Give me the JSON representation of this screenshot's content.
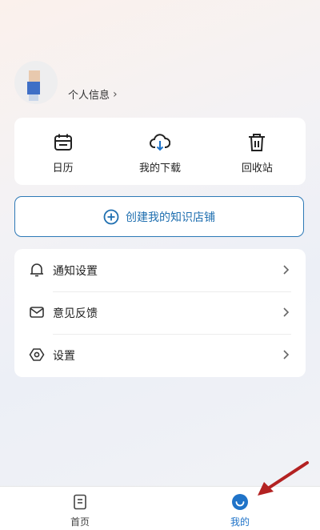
{
  "profile": {
    "info_link": "个人信息"
  },
  "quick_actions": [
    {
      "label": "日历",
      "icon": "calendar-icon"
    },
    {
      "label": "我的下载",
      "icon": "cloud-download-icon"
    },
    {
      "label": "回收站",
      "icon": "trash-icon"
    }
  ],
  "create_store": {
    "label": "创建我的知识店铺",
    "icon": "plus-circle-icon"
  },
  "menu": [
    {
      "label": "通知设置",
      "icon": "bell-icon"
    },
    {
      "label": "意见反馈",
      "icon": "mail-icon"
    },
    {
      "label": "设置",
      "icon": "settings-hex-icon"
    }
  ],
  "tabbar": {
    "tabs": [
      {
        "label": "首页",
        "icon": "home-doc-icon",
        "active": false
      },
      {
        "label": "我的",
        "icon": "smile-circle-icon",
        "active": true
      }
    ]
  },
  "colors": {
    "accent": "#1f73c8",
    "annotation_arrow": "#b32222"
  }
}
